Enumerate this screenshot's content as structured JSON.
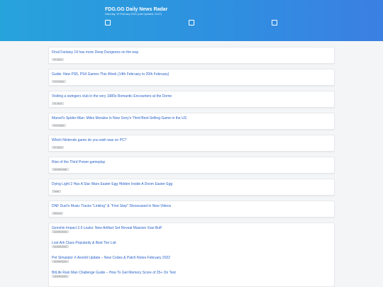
{
  "header": {
    "title": "FDG.GG Daily News Radar",
    "subtitle": "Saturday, 19 February 2022 (Last Updated: 23:07)"
  },
  "articles": [
    {
      "title": "Final Fantasy 14 has more Deep Dungeons on the way",
      "source": "PC Gamer"
    },
    {
      "title": "Guide: New PS5, PS4 Games This Week (14th February to 20th February)",
      "source": "Push Square"
    },
    {
      "title": "Visiting a swingers club in the very 1980s Romantic Encounters at the Dome",
      "source": "PC Gamer"
    },
    {
      "title": "Marvel's Spider-Man: Miles Morales Is Now Sony's Third Best-Selling Game in the US",
      "source": "Push Square"
    },
    {
      "title": "Which Nintendo game do you wish was on PC?",
      "source": "PC Gamer"
    },
    {
      "title": "Rise of the Third Power gameplay",
      "source": "Gameplay.today"
    },
    {
      "title": "Dying Light 2 Has A Star Wars Easter Egg Hidden Inside A Doom Easter Egg",
      "source": "Kotaku"
    },
    {
      "title": "DNF Duel's Music Tracks \"Linking\" & \"First Step\" Showcased in New Videos",
      "source": "Siliconera"
    }
  ],
  "grouped": [
    {
      "title": "Genshin Impact 2.6 Leaks: New Artifact Set Reveal Massive Xiao Buff",
      "source": "GameRevolution"
    },
    {
      "title": "Lost Ark Class Popularity & Best Tier List",
      "source": "GameRevolution"
    },
    {
      "title": "Pet Simulator X Axolotl Update – New Codes & Patch Notes February 2022",
      "source": "GameRevolution"
    },
    {
      "title": "BitLife Rain Man Challenge Guide – How To Get Memory Score of 25+ On Test",
      "source": "GameRevolution"
    }
  ]
}
